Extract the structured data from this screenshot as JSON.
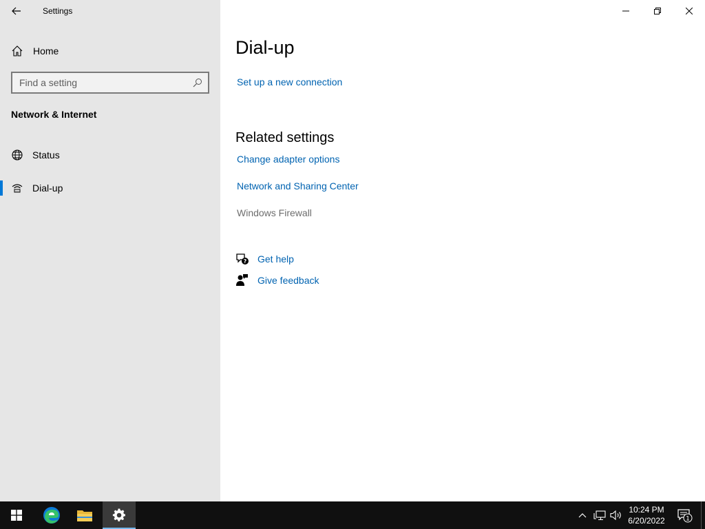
{
  "window": {
    "app_title": "Settings",
    "icons": {
      "back": "back-arrow-icon",
      "minimize": "minimize-icon",
      "restore": "restore-icon",
      "close": "close-icon"
    }
  },
  "sidebar": {
    "home_label": "Home",
    "search_placeholder": "Find a setting",
    "section_title": "Network & Internet",
    "items": [
      {
        "label": "Status",
        "icon": "globe-icon",
        "selected": false
      },
      {
        "label": "Dial-up",
        "icon": "dialup-icon",
        "selected": true
      }
    ]
  },
  "main": {
    "page_title": "Dial-up",
    "setup_link": "Set up a new connection",
    "related_title": "Related settings",
    "related_links": [
      {
        "label": "Change adapter options",
        "enabled": true
      },
      {
        "label": "Network and Sharing Center",
        "enabled": true
      },
      {
        "label": "Windows Firewall",
        "enabled": false
      }
    ],
    "help": {
      "get_help": "Get help",
      "give_feedback": "Give feedback"
    }
  },
  "taskbar": {
    "time": "10:24 PM",
    "date": "6/20/2022",
    "notification_count": "1"
  },
  "colors": {
    "accent": "#0078d7",
    "link": "#0063b1",
    "sidebar_bg": "#e6e6e6",
    "taskbar_bg": "#101010"
  }
}
